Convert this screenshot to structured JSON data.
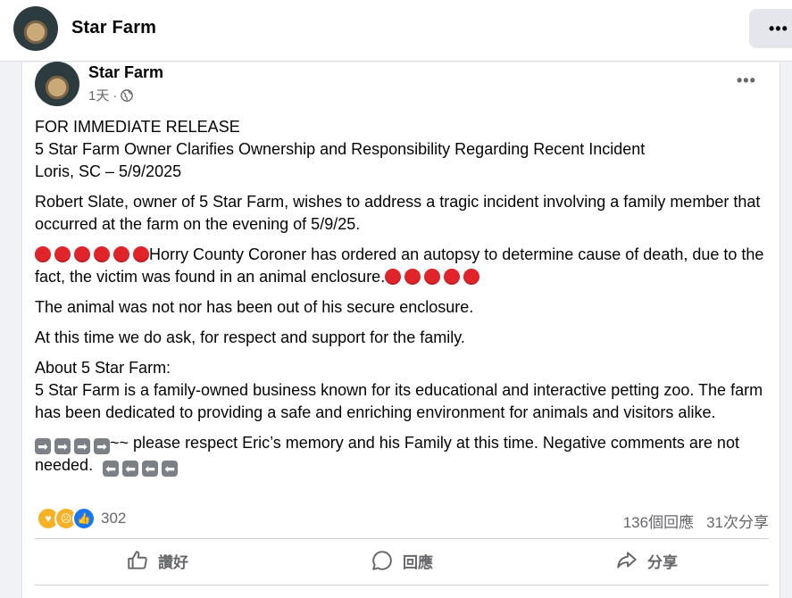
{
  "header": {
    "title": "Star Farm"
  },
  "post": {
    "author": "Star Farm",
    "time": "1天 ·",
    "paragraphs": {
      "p1": [
        "FOR IMMEDIATE RELEASE",
        "5 Star Farm Owner Clarifies Ownership and Responsibility Regarding Recent Incident",
        "Loris, SC – 5/9/2025"
      ],
      "p2": "Robert Slate, owner of 5 Star Farm, wishes to address a tragic incident involving a family member that occurred at the farm on the evening of 5/9/25.",
      "p3": "Horry County Coroner has ordered an autopsy to determine cause of death, due to the fact, the victim was found in an animal enclosure.",
      "p4": "The animal was not nor has been out of his secure enclosure.",
      "p5": "At this time we do ask, for respect and support for the family.",
      "p6_title": "About 5 Star Farm:",
      "p6": "5 Star Farm is a family-owned business known for its educational and interactive petting zoo. The farm has been dedicated to providing a safe and enriching environment for animals and visitors alike.",
      "p7": "~~ please respect Eric’s memory and his Family at this time.  Negative comments are not needed."
    },
    "reaction_count": "302",
    "comments": "136個回應",
    "shares": "31次分享",
    "actions": {
      "like": "讚好",
      "comment": "回應",
      "share": "分享"
    }
  },
  "icons": {
    "more": "more-icon",
    "globe": "globe-icon",
    "like": "thumbs-up-icon",
    "comment": "comment-bubble-icon",
    "share": "share-arrow-icon"
  },
  "colors": {
    "like_blue": "#1877f2",
    "red_dot": "#e0242a",
    "gray_text": "#65676b"
  }
}
